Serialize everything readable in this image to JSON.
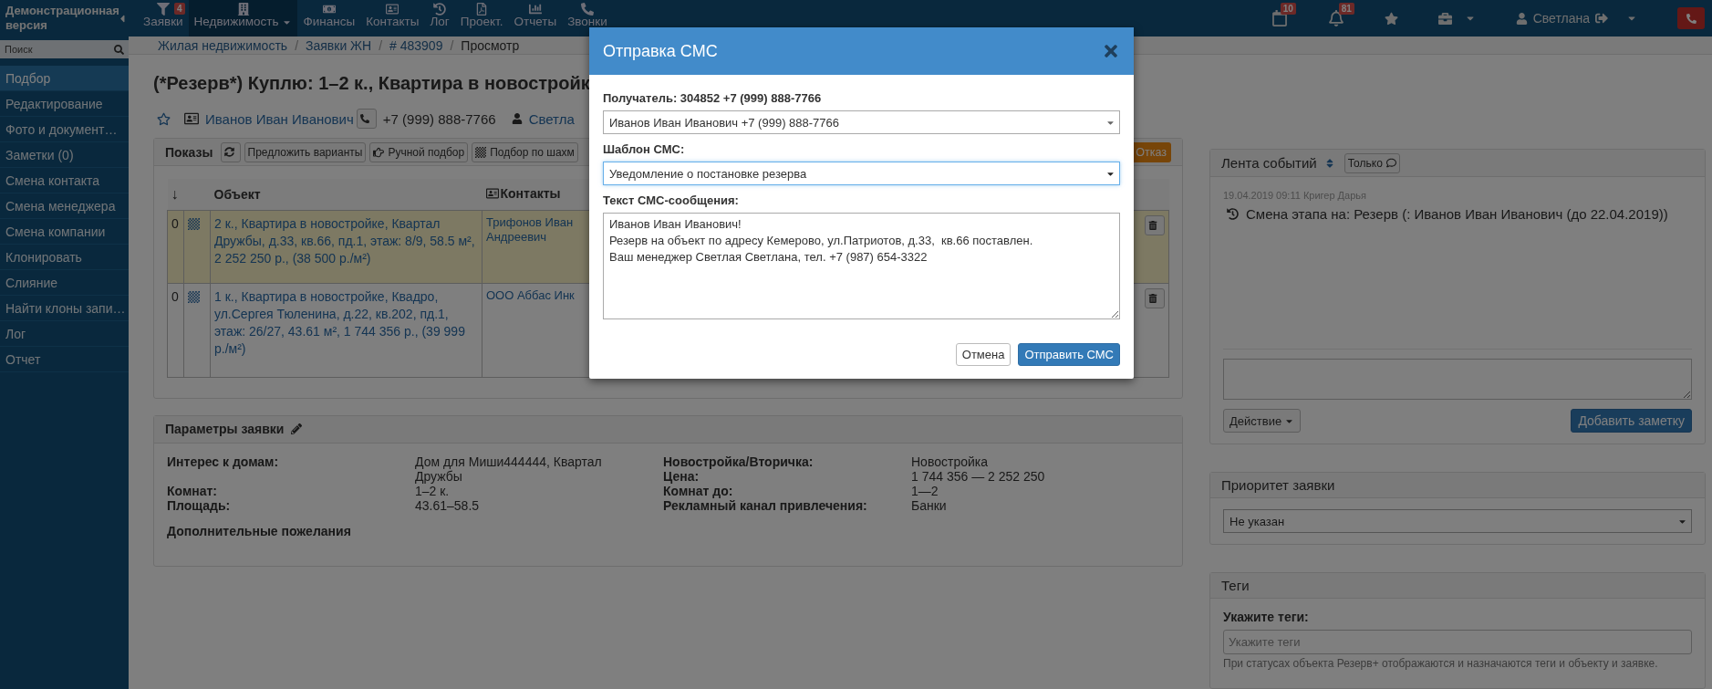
{
  "top_nav": {
    "brand": "Демонстрационная версия",
    "items": [
      {
        "label": "Заявки",
        "badge": "4",
        "selected": false,
        "dropdown": false
      },
      {
        "label": "Недвижимость",
        "selected": true,
        "dropdown": true
      },
      {
        "label": "Финансы",
        "selected": false,
        "dropdown": false
      },
      {
        "label": "Контакты",
        "selected": false,
        "dropdown": false
      },
      {
        "label": "Лог",
        "selected": false,
        "dropdown": false
      },
      {
        "label": "Проект.",
        "selected": false,
        "dropdown": false
      },
      {
        "label": "Отчеты",
        "selected": false,
        "dropdown": false
      },
      {
        "label": "Звонки",
        "selected": false,
        "dropdown": false
      }
    ],
    "calendar_badge": "10",
    "bell_badge": "81",
    "user": "Светлана"
  },
  "sidebar": {
    "search_placeholder": "Поиск",
    "items": [
      {
        "label": "Подбор",
        "selected": true
      },
      {
        "label": "Редактирование",
        "selected": false
      },
      {
        "label": "Фото и документ…",
        "selected": false
      },
      {
        "label": "Заметки (0)",
        "selected": false
      },
      {
        "label": "Смена контакта",
        "selected": false
      },
      {
        "label": "Смена менеджера",
        "selected": false
      },
      {
        "label": "Смена компании",
        "selected": false
      },
      {
        "label": "Клонировать",
        "selected": false
      },
      {
        "label": "Слияние",
        "selected": false
      },
      {
        "label": "Найти клоны запи…",
        "selected": false
      },
      {
        "label": "Лог",
        "selected": false
      },
      {
        "label": "Отчет",
        "selected": false
      }
    ]
  },
  "breadcrumbs": [
    {
      "label": "Жилая недвижимость",
      "link": true
    },
    {
      "separator": "/",
      "label": "Заявки ЖН",
      "link": true
    },
    {
      "separator": "/",
      "label": "# 483909",
      "link": true
    },
    {
      "separator": "/",
      "label": "Просмотр",
      "link": false
    }
  ],
  "title": "(*Резерв*) Куплю: 1–2 к., Квартира в новостройк",
  "contact": {
    "name": "Иванов Иван Иванович",
    "phone": "+7 (999) 888-7766",
    "manager": "Светла"
  },
  "shows": {
    "title": "Показы",
    "buttons": [
      "Предложить варианты",
      "Ручной подбор",
      "Подбор по шахм"
    ],
    "reject": "Отказ",
    "columns": [
      "↓",
      "Объект",
      "Контакты"
    ],
    "rows": [
      {
        "number": "0",
        "object": "2 к., Квартира в новостройке, Квартал Дружбы, д.33, кв.66, пд.1, этаж: 8/9, 58.5 м², 2 252 250 р., (38 500 р./м²)",
        "contact": "Трифонов Иван Андреевич",
        "highlighted": true
      },
      {
        "number": "0",
        "object": "1 к., Квартира в новостройке, Квадро, ул.Сергея Тюленина, д.22, кв.202, пд.1, этаж: 26/27, 43.61 м², 1 744 356 р., (39 999 р./м²)",
        "contact": "ООО Аббас Инк",
        "highlighted": false
      }
    ]
  },
  "params": {
    "title": "Параметры заявки",
    "left": [
      {
        "label": "Интерес к домам:",
        "value": "Дом для Миши444444, Квартал Дружбы"
      },
      {
        "label": "Комнат:",
        "value": "1–2 к."
      },
      {
        "label": "Площадь:",
        "value": "43.61–58.5"
      }
    ],
    "right": [
      {
        "label": "Новостройка/Вторичка:",
        "value": "Новостройка"
      },
      {
        "label": "Цена:",
        "value": "1 744 356 — 2 252 250"
      },
      {
        "label": "Комнат до:",
        "value": "1—2"
      },
      {
        "label": "Рекламный канал привлечения:",
        "value": "Банки"
      }
    ],
    "extra": "Дополнительные пожелания"
  },
  "events": {
    "title": "Лента событий",
    "filter": "Только",
    "items": [
      {
        "meta": "19.04.2019 09:11 Кригер Дарья",
        "text": "Смена этапа на: Резерв (: Иванов Иван Иванович (до 22.04.2019))"
      }
    ],
    "action": "Действие",
    "add": "Добавить заметку"
  },
  "priority": {
    "title": "Приоритет заявки",
    "value": "Не указан"
  },
  "tags": {
    "title": "Теги",
    "label": "Укажите теги:",
    "placeholder": "Укажите теги",
    "hint": "При статусах объекта Резерв+ отображаются и назначаются теги и объекту и заявке."
  },
  "modal": {
    "title": "Отправка СМС",
    "recipient_label": "Получатель: 304852 +7 (999) 888-7766",
    "recipient": "Иванов Иван Иванович +7 (999) 888-7766",
    "template_label": "Шаблон СМС:",
    "template": "Уведомление о постановке резерва",
    "template_focused": true,
    "text_label": "Текст СМС-сообщения:",
    "text": "Иванов Иван Иванович!\nРезерв на объект по адресу Кемерово, ул.Патриотов, д.33,  кв.66 поставлен.\nВаш менеджер Светлая Светлана, тел. +7 (987) 654-3322",
    "cancel": "Отмена",
    "send": "Отправить СМС"
  }
}
